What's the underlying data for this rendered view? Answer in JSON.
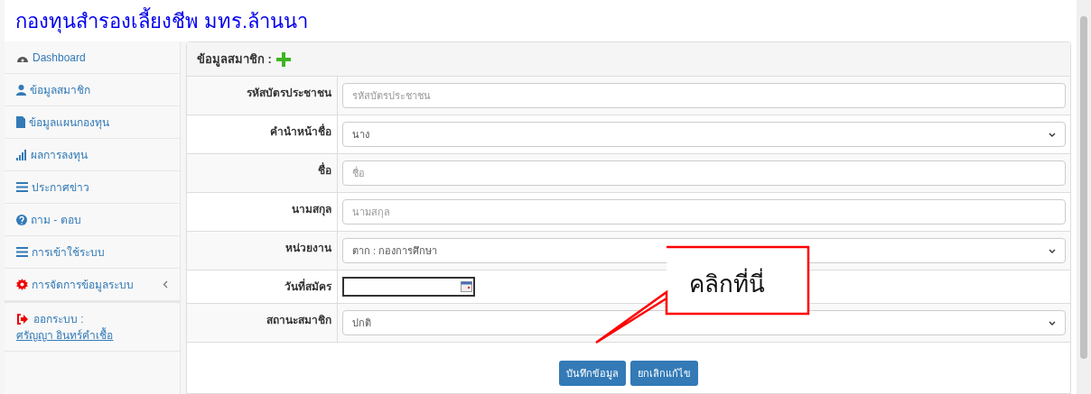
{
  "header": {
    "title": "กองทุนสำรองเลี้ยงชีพ มทร.ล้านนา"
  },
  "sidebar": {
    "items": [
      {
        "label": "Dashboard",
        "has_submenu": false
      },
      {
        "label": "ข้อมูลสมาชิก",
        "has_submenu": false
      },
      {
        "label": "ข้อมูลแผนกองทุน",
        "has_submenu": false
      },
      {
        "label": "ผลการลงทุน",
        "has_submenu": false
      },
      {
        "label": "ประกาศข่าว",
        "has_submenu": false
      },
      {
        "label": "ถาม - ตอบ",
        "has_submenu": false
      },
      {
        "label": "การเข้าใช้ระบบ",
        "has_submenu": false
      },
      {
        "label": "การจัดการข้อมูลระบบ",
        "has_submenu": true
      }
    ],
    "logout": {
      "label": "ออกระบบ :",
      "user": "ศรัญญา อินทร์คำเชื้อ"
    }
  },
  "panel": {
    "title": "ข้อมูลสมาชิก :",
    "fields": [
      {
        "label": "รหัสบัตรประชาชน",
        "kind": "text",
        "placeholder": "รหัสบัตรประชาชน"
      },
      {
        "label": "คำนำหน้าชื่อ",
        "kind": "select",
        "value": "นาง"
      },
      {
        "label": "ชื่อ",
        "kind": "text",
        "placeholder": "ชื่อ"
      },
      {
        "label": "นามสกุล",
        "kind": "text",
        "placeholder": "นามสกุล"
      },
      {
        "label": "หน่วยงาน",
        "kind": "select",
        "value": "ตาก : กองการศึกษา"
      },
      {
        "label": "วันที่สมัคร",
        "kind": "date"
      },
      {
        "label": "สถานะสมาชิก",
        "kind": "select",
        "value": "ปกติ"
      }
    ],
    "buttons": [
      "บันทึกข้อมูล",
      "ยกเลิกแก้ไข"
    ]
  },
  "callout": {
    "text": "คลิกที่นี่"
  }
}
